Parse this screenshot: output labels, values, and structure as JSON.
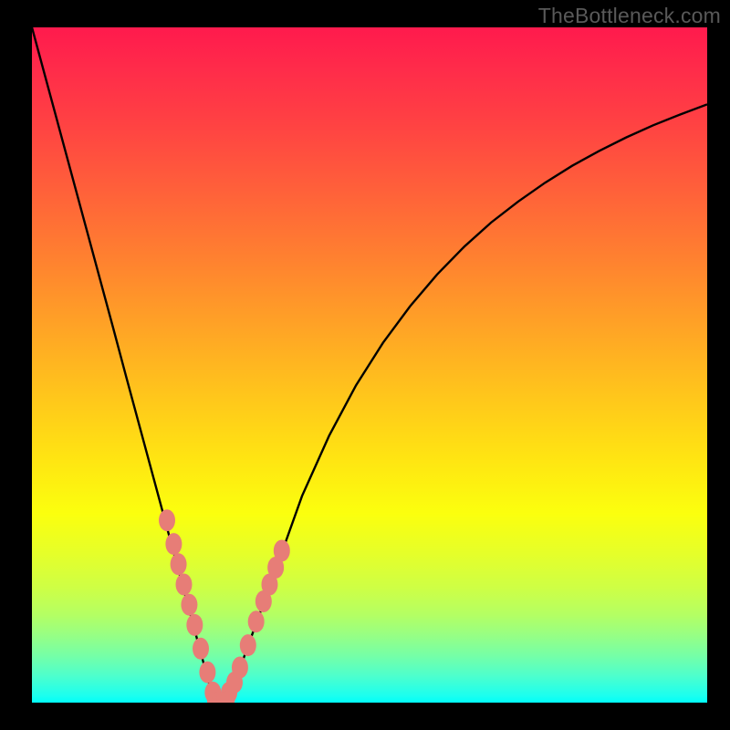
{
  "watermark": {
    "text": "TheBottleneck.com"
  },
  "colors": {
    "frame": "#000000",
    "curve": "#000000",
    "marker_fill": "#e77d77",
    "marker_stroke": "#d96a64"
  },
  "chart_data": {
    "type": "line",
    "title": "",
    "xlabel": "",
    "ylabel": "",
    "xlim": [
      0,
      100
    ],
    "ylim": [
      0,
      100
    ],
    "x": [
      0,
      2,
      4,
      6,
      8,
      10,
      12,
      14,
      16,
      18,
      20,
      22,
      24,
      26,
      27,
      28,
      29,
      30,
      32,
      34,
      36,
      38,
      40,
      44,
      48,
      52,
      56,
      60,
      64,
      68,
      72,
      76,
      80,
      84,
      88,
      92,
      96,
      100
    ],
    "y": [
      100,
      92.6,
      85.2,
      77.8,
      70.4,
      63.0,
      55.6,
      48.1,
      40.7,
      33.3,
      25.9,
      18.5,
      11.1,
      3.7,
      0,
      0,
      0,
      2.8,
      8.4,
      13.9,
      19.4,
      25.0,
      30.6,
      39.5,
      47.0,
      53.3,
      58.7,
      63.4,
      67.5,
      71.1,
      74.2,
      77.0,
      79.5,
      81.7,
      83.7,
      85.5,
      87.1,
      88.6
    ],
    "markers": {
      "left_branch": [
        {
          "x": 20,
          "y": 27
        },
        {
          "x": 21,
          "y": 23.5
        },
        {
          "x": 21.7,
          "y": 20.5
        },
        {
          "x": 22.5,
          "y": 17.5
        },
        {
          "x": 23.3,
          "y": 14.5
        },
        {
          "x": 24.1,
          "y": 11.5
        },
        {
          "x": 25,
          "y": 8
        },
        {
          "x": 26,
          "y": 4.5
        },
        {
          "x": 26.8,
          "y": 1.5
        }
      ],
      "right_branch": [
        {
          "x": 29.2,
          "y": 1.5
        },
        {
          "x": 30,
          "y": 3
        },
        {
          "x": 30.8,
          "y": 5.2
        },
        {
          "x": 32,
          "y": 8.5
        },
        {
          "x": 33.2,
          "y": 12
        },
        {
          "x": 34.3,
          "y": 15
        },
        {
          "x": 35.2,
          "y": 17.5
        },
        {
          "x": 36.1,
          "y": 20
        },
        {
          "x": 37,
          "y": 22.5
        }
      ],
      "bottom": [
        {
          "x": 27,
          "y": 0.4
        },
        {
          "x": 27.7,
          "y": 0.4
        },
        {
          "x": 28.4,
          "y": 0.4
        },
        {
          "x": 29,
          "y": 0.5
        }
      ]
    }
  }
}
